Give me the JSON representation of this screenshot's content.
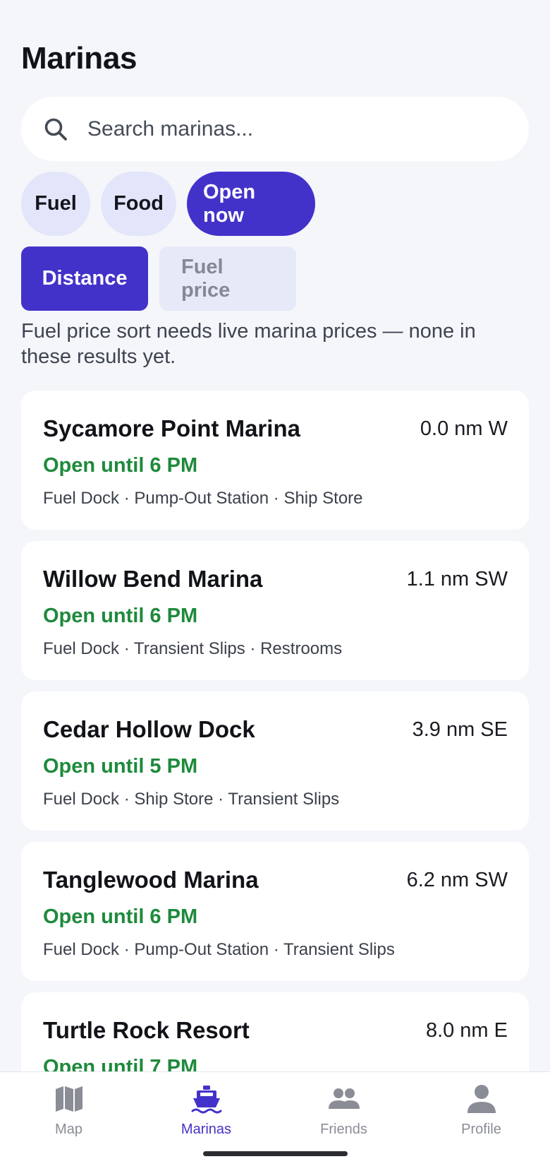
{
  "header": {
    "title": "Marinas"
  },
  "search": {
    "placeholder": "Search marinas..."
  },
  "filters": [
    {
      "label": "Fuel",
      "active": false
    },
    {
      "label": "Food",
      "active": false
    },
    {
      "label": "Open now",
      "active": true
    }
  ],
  "sort": {
    "options": [
      {
        "label": "Distance",
        "active": true
      },
      {
        "label": "Fuel price",
        "active": false,
        "disabled": true
      }
    ],
    "note": "Fuel price sort needs live marina prices — none in these results yet."
  },
  "marinas": [
    {
      "name": "Sycamore Point Marina",
      "distance": "0.0 nm W",
      "hours": "Open until 6 PM",
      "amenities": "Fuel Dock · Pump-Out Station · Ship Store"
    },
    {
      "name": "Willow Bend Marina",
      "distance": "1.1 nm SW",
      "hours": "Open until 6 PM",
      "amenities": "Fuel Dock · Transient Slips · Restrooms"
    },
    {
      "name": "Cedar Hollow Dock",
      "distance": "3.9 nm SE",
      "hours": "Open until 5 PM",
      "amenities": "Fuel Dock · Ship Store · Transient Slips"
    },
    {
      "name": "Tanglewood Marina",
      "distance": "6.2 nm SW",
      "hours": "Open until 6 PM",
      "amenities": "Fuel Dock · Pump-Out Station · Transient Slips"
    },
    {
      "name": "Turtle Rock Resort",
      "distance": "8.0 nm E",
      "hours": "Open until 7 PM",
      "amenities": ""
    }
  ],
  "tabs": [
    {
      "label": "Map",
      "icon": "map-icon",
      "active": false
    },
    {
      "label": "Marinas",
      "icon": "boat-icon",
      "active": true
    },
    {
      "label": "Friends",
      "icon": "people-icon",
      "active": false
    },
    {
      "label": "Profile",
      "icon": "person-icon",
      "active": false
    }
  ],
  "colors": {
    "accent": "#4332c9",
    "open_status": "#1e8a3c",
    "chip_inactive": "#e3e6fb",
    "background": "#f4f6fa"
  }
}
